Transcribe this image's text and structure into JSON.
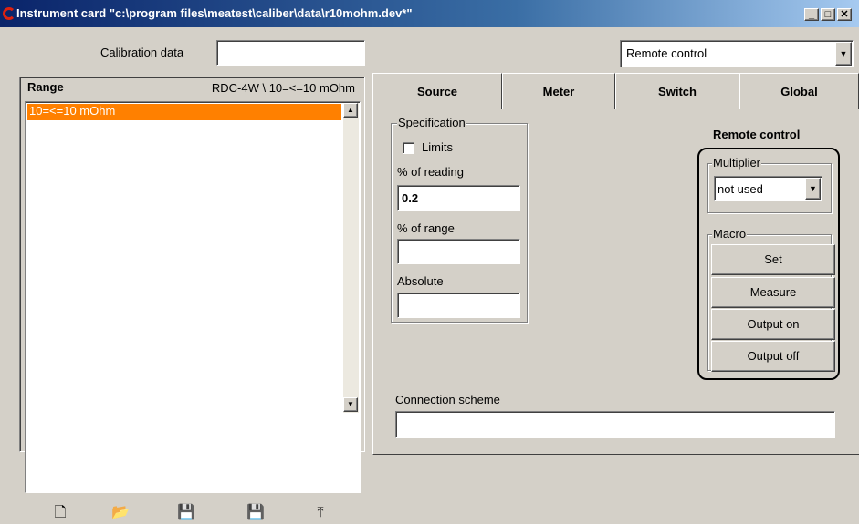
{
  "window": {
    "title": "Instrument card \"c:\\program files\\meatest\\caliber\\data\\r10mohm.dev*\""
  },
  "calibration": {
    "label": "Calibration data",
    "value": ""
  },
  "mode_select": {
    "value": "Remote control"
  },
  "range_panel": {
    "header_label": "Range",
    "header_value": "RDC-4W \\ 10=<=10 mOhm",
    "items": [
      "10=<=10 mOhm"
    ]
  },
  "tabs": [
    "Source",
    "Meter",
    "Switch",
    "Global"
  ],
  "specification": {
    "legend": "Specification",
    "limits_label": "Limits",
    "reading_label": "% of reading",
    "reading_value": "0.2",
    "range_label": "% of range",
    "range_value": "",
    "absolute_label": "Absolute",
    "absolute_value": ""
  },
  "remote": {
    "title": "Remote control",
    "multiplier_legend": "Multiplier",
    "multiplier_value": "not used",
    "macro_legend": "Macro",
    "buttons": [
      "Set",
      "Measure",
      "Output on",
      "Output off"
    ]
  },
  "connection": {
    "label": "Connection scheme",
    "value": ""
  },
  "colors": {
    "selection": "#ff8000",
    "title_start": "#0a246a",
    "face": "#d4d0c8"
  }
}
